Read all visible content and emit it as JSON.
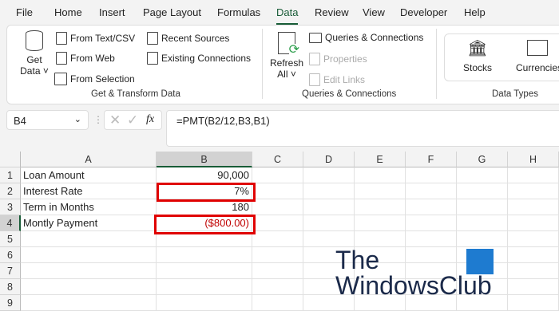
{
  "tabs": [
    "File",
    "Home",
    "Insert",
    "Page Layout",
    "Formulas",
    "Data",
    "Review",
    "View",
    "Developer",
    "Help"
  ],
  "ribbon": {
    "get_data": [
      "Get",
      "Data ˅"
    ],
    "get_transform": [
      "From Text/CSV",
      "From Web",
      "From Selection",
      "Recent Sources",
      "Existing Connections"
    ],
    "get_transform_label": "Get & Transform Data",
    "refresh": [
      "Refresh",
      "All ˅"
    ],
    "queries": [
      "Queries & Connections",
      "Properties",
      "Edit Links"
    ],
    "queries_label": "Queries & Connections",
    "data_types": [
      "Stocks",
      "Currencies"
    ],
    "data_types_label": "Data Types"
  },
  "name_box": "B4",
  "fx": "fx",
  "formula": "=PMT(B2/12,B3,B1)",
  "columns": [
    "A",
    "B",
    "C",
    "D",
    "E",
    "F",
    "G",
    "H"
  ],
  "rows": [
    "1",
    "2",
    "3",
    "4",
    "5",
    "6",
    "7",
    "8",
    "9"
  ],
  "cells": [
    [
      "Loan Amount",
      "90,000"
    ],
    [
      "Interest Rate",
      "7%"
    ],
    [
      "Term in Months",
      "180"
    ],
    [
      "Montly Payment",
      "($800.00)"
    ]
  ],
  "watermark": [
    "The",
    "WindowsClub"
  ],
  "colors": {
    "accent": "#185c37",
    "highlight": "#e00000",
    "negative": "#c00000"
  }
}
